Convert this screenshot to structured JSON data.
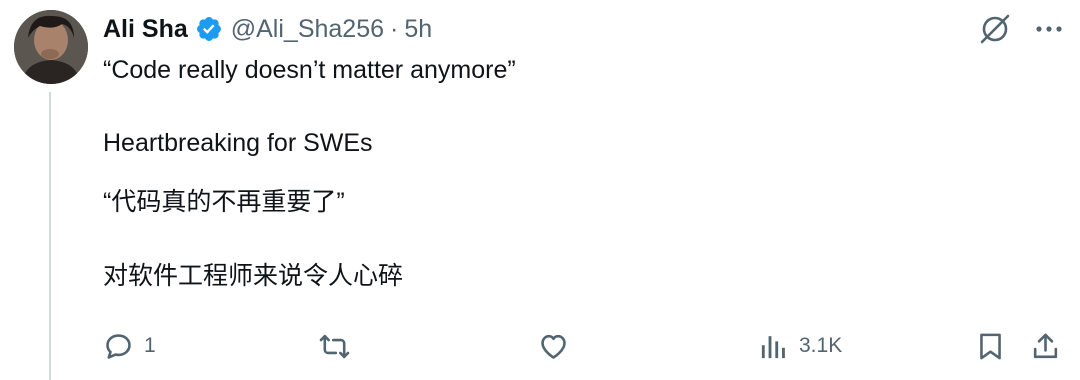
{
  "author": {
    "name": "Ali Sha",
    "handle": "@Ali_Sha256",
    "separator": "·",
    "time": "5h",
    "verified": true
  },
  "tweet": {
    "lines": [
      "“Code really doesn’t matter anymore”",
      "Heartbreaking for SWEs",
      "“代码真的不再重要了”",
      "对软件工程师来说令人心碎"
    ]
  },
  "engagement": {
    "replies": "1",
    "retweets": "",
    "likes": "",
    "views": "3.1K"
  },
  "icons": {
    "verified": "verified-badge-icon",
    "grok": "grok-icon",
    "more": "more-icon",
    "reply": "reply-icon",
    "retweet": "retweet-icon",
    "like": "like-icon",
    "views": "views-icon",
    "bookmark": "bookmark-icon",
    "share": "share-icon"
  },
  "colors": {
    "verified": "#1d9bf0",
    "text_primary": "#0f1419",
    "text_secondary": "#536471",
    "thread_line": "#cfd9de"
  }
}
